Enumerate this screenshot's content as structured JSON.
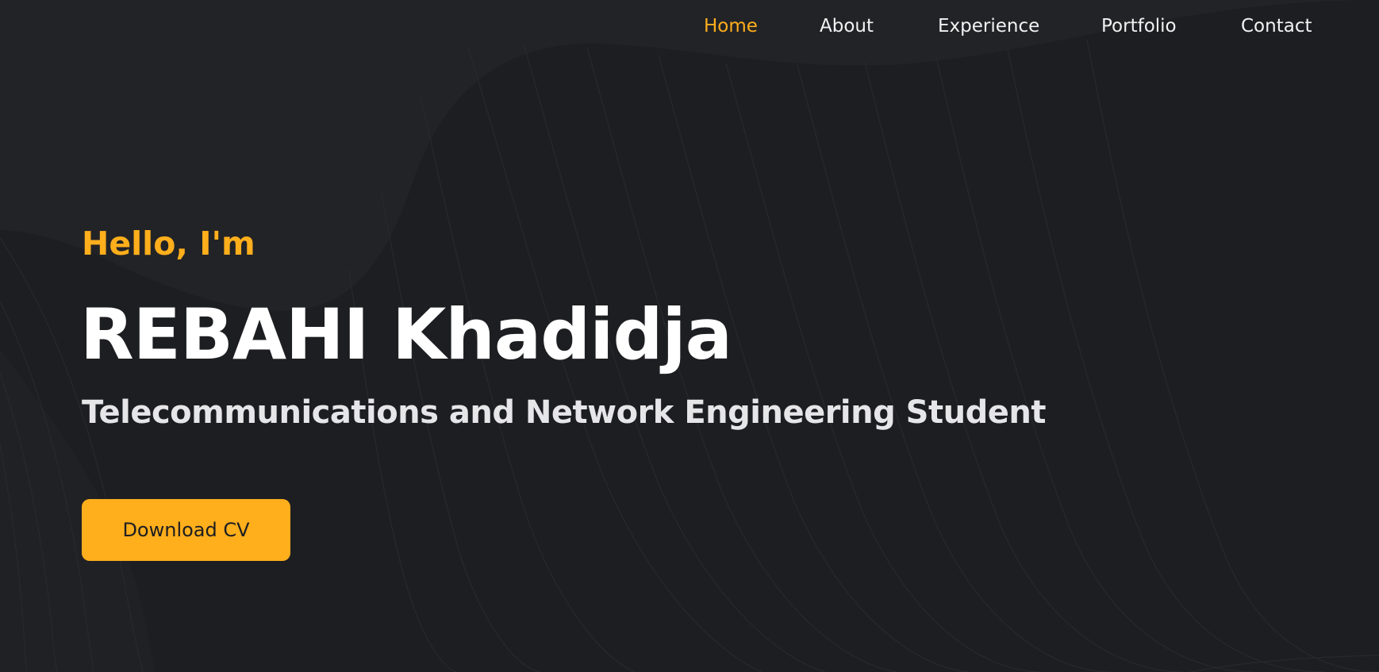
{
  "nav": {
    "items": [
      {
        "label": "Home",
        "active": true
      },
      {
        "label": "About",
        "active": false
      },
      {
        "label": "Experience",
        "active": false
      },
      {
        "label": "Portfolio",
        "active": false
      },
      {
        "label": "Contact",
        "active": false
      }
    ]
  },
  "hero": {
    "greeting": "Hello, I'm",
    "name": "REBAHI Khadidja",
    "role": "Telecommunications and Network Engineering Student",
    "cta_label": "Download CV"
  },
  "colors": {
    "background": "#1d1e21",
    "accent": "#ffae1c",
    "text": "#ffffff",
    "muted_text": "#e6e6e8"
  }
}
